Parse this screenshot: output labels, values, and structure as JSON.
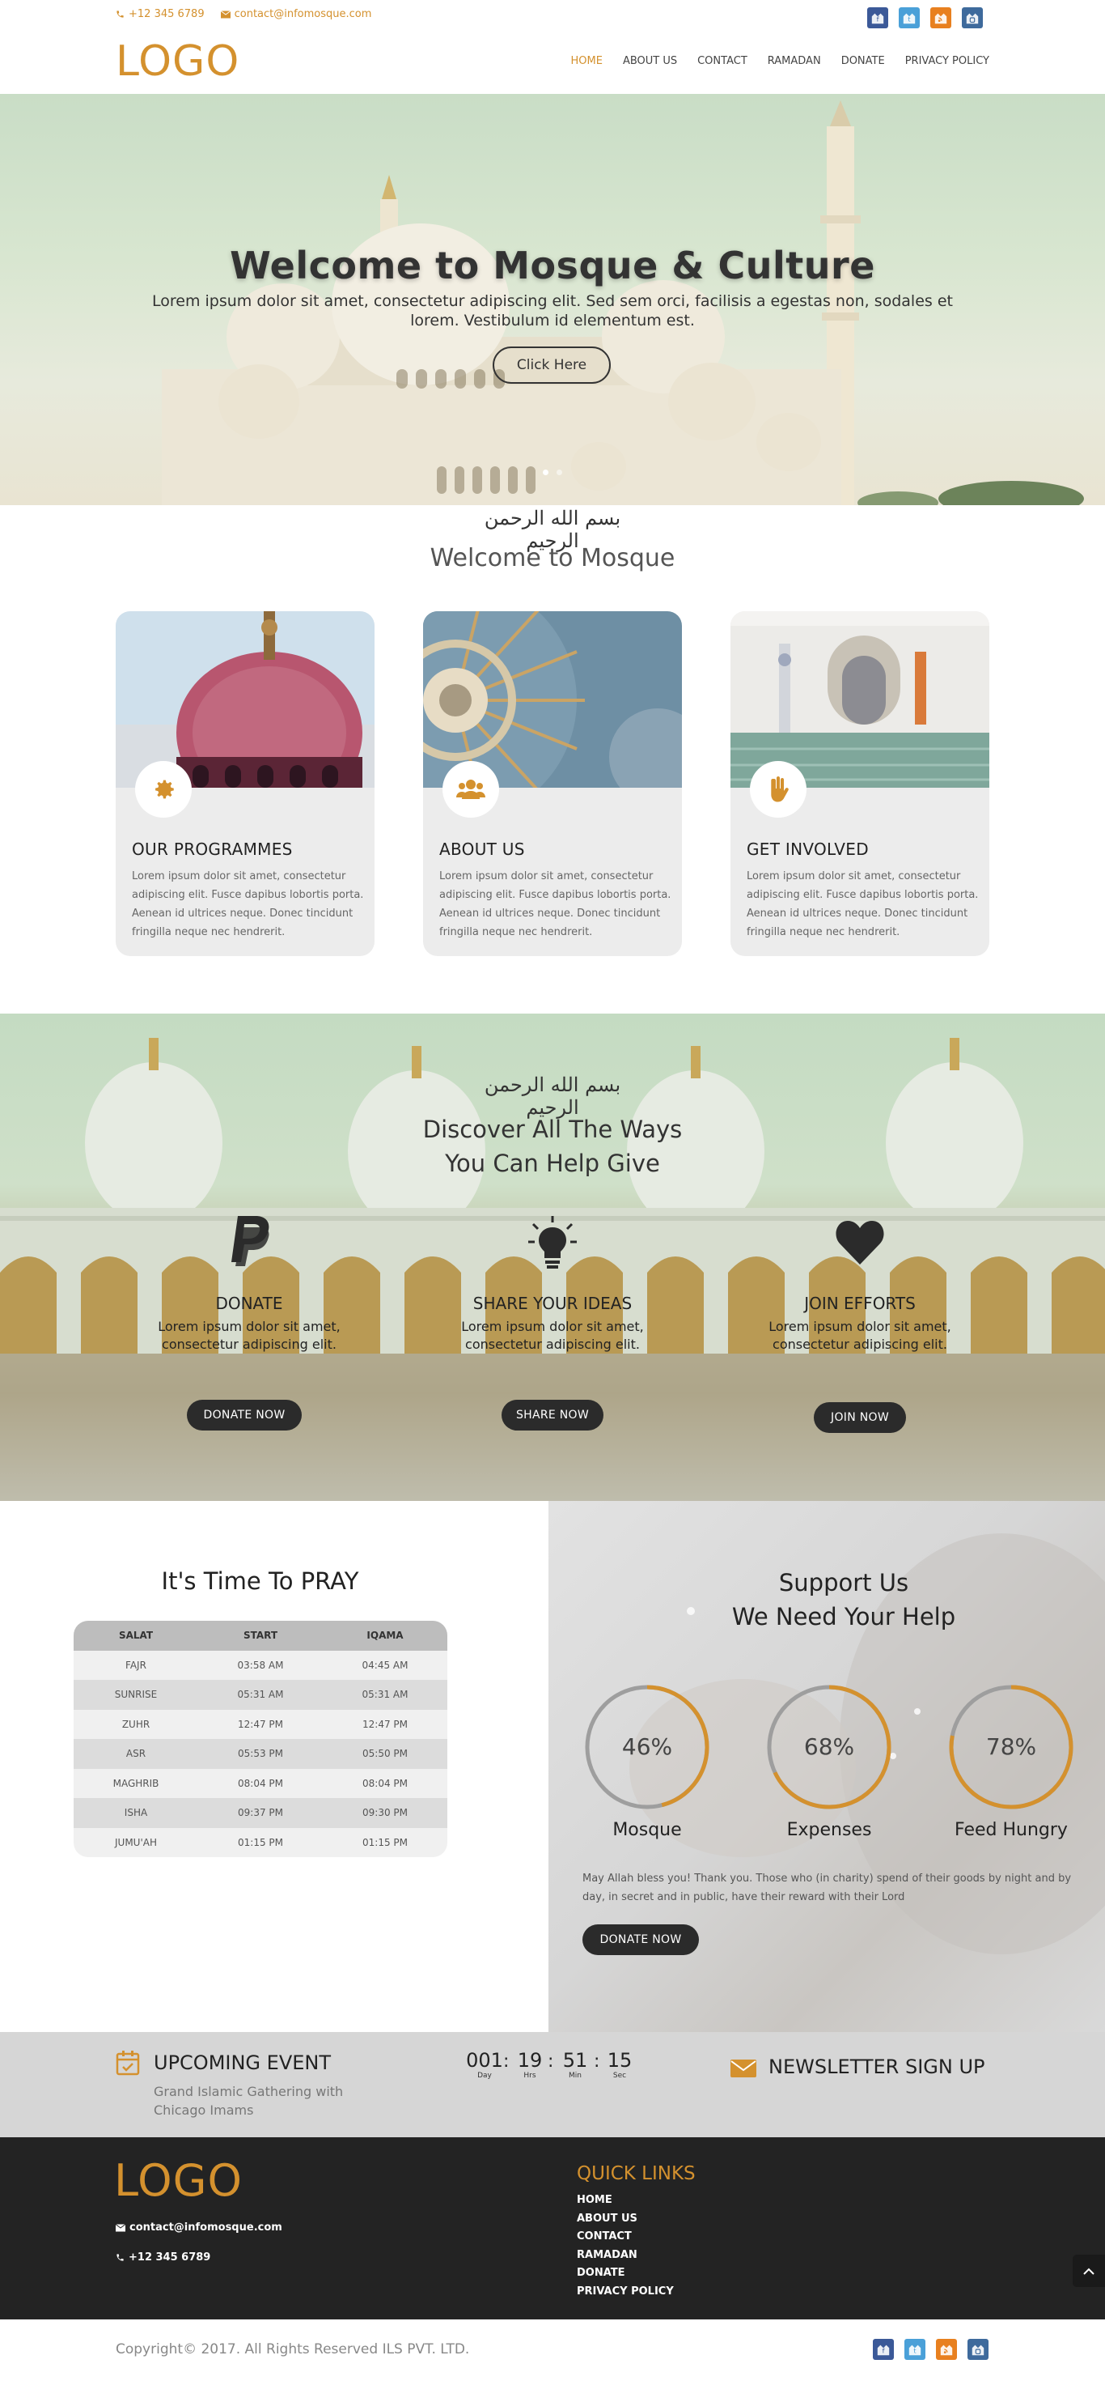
{
  "topbar": {
    "phone": "+12 345 6789",
    "email": "contact@infomosque.com",
    "social_icons": [
      "facebook-icon",
      "twitter-icon",
      "rss-icon",
      "instagram-icon"
    ]
  },
  "header": {
    "logo": "LOGO",
    "nav": [
      "HOME",
      "ABOUT US",
      "CONTACT",
      "RAMADAN",
      "DONATE",
      "PRIVACY POLICY"
    ],
    "active": "HOME"
  },
  "hero": {
    "title": "Welcome to Mosque & Culture",
    "subtitle": "Lorem ipsum dolor sit amet, consectetur adipiscing elit. Sed sem orci, facilisis a egestas non, sodales et lorem. Vestibulum id elementum est.",
    "button": "Click Here",
    "slides": 2,
    "active_slide": 1
  },
  "welcome": {
    "calligraphy": "بسم الله الرحمن الرحيم",
    "title": "Welcome to Mosque",
    "cards": [
      {
        "title": "OUR PROGRAMMES",
        "icon": "gear-icon",
        "text": "Lorem ipsum dolor sit amet, consectetur adipiscing elit. Fusce dapibus lobortis porta. Aenean id ultrices neque. Donec tincidunt fringilla neque nec hendrerit."
      },
      {
        "title": "ABOUT US",
        "icon": "users-icon",
        "text": "Lorem ipsum dolor sit amet, consectetur adipiscing elit. Fusce dapibus lobortis porta. Aenean id ultrices neque. Donec tincidunt fringilla neque nec hendrerit."
      },
      {
        "title": "GET INVOLVED",
        "icon": "hand-icon",
        "text": "Lorem ipsum dolor sit amet, consectetur adipiscing elit. Fusce dapibus lobortis porta. Aenean id ultrices neque. Donec tincidunt fringilla neque nec hendrerit."
      }
    ]
  },
  "help": {
    "calligraphy": "بسم الله الرحمن الرحيم",
    "title_line1": "Discover All The Ways",
    "title_line2": "You Can Help Give",
    "columns": [
      {
        "title": "DONATE",
        "icon": "paypal-icon",
        "text": "Lorem ipsum dolor sit amet, consectetur adipiscing elit.",
        "button": "DONATE NOW"
      },
      {
        "title": "SHARE YOUR IDEAS",
        "icon": "lightbulb-icon",
        "text": "Lorem ipsum dolor sit amet, consectetur adipiscing elit.",
        "button": "SHARE NOW"
      },
      {
        "title": "JOIN EFFORTS",
        "icon": "heart-icon",
        "text": "Lorem ipsum dolor sit amet, consectetur adipiscing elit.",
        "button": "JOIN NOW"
      }
    ]
  },
  "prayer": {
    "title": "It's Time To PRAY",
    "headers": [
      "SALAT",
      "START",
      "IQAMA"
    ],
    "rows": [
      [
        "FAJR",
        "03:58 AM",
        "04:45 AM"
      ],
      [
        "SUNRISE",
        "05:31 AM",
        "05:31 AM"
      ],
      [
        "ZUHR",
        "12:47 PM",
        "12:47 PM"
      ],
      [
        "ASR",
        "05:53 PM",
        "05:50 PM"
      ],
      [
        "MAGHRIB",
        "08:04 PM",
        "08:04 PM"
      ],
      [
        "ISHA",
        "09:37 PM",
        "09:30 PM"
      ],
      [
        "JUMU'AH",
        "01:15 PM",
        "01:15 PM"
      ]
    ]
  },
  "support": {
    "title_line1": "Support Us",
    "title_line2": "We Need Your Help",
    "circles": [
      {
        "value": 46,
        "label_value": "46%",
        "label": "Mosque"
      },
      {
        "value": 68,
        "label_value": "68%",
        "label": "Expenses"
      },
      {
        "value": 78,
        "label_value": "78%",
        "label": "Feed Hungry"
      }
    ],
    "quote": "May Allah bless you! Thank you. Those who (in charity) spend of their goods by night and by day, in secret and in public, have their reward with their Lord",
    "button": "DONATE NOW"
  },
  "events": {
    "title": "UPCOMING EVENT",
    "event_name": "Grand Islamic Gathering with Chicago Imams",
    "countdown": [
      {
        "value": "001",
        "unit": "Day"
      },
      {
        "value": "19",
        "unit": "Hrs"
      },
      {
        "value": "51",
        "unit": "Min"
      },
      {
        "value": "15",
        "unit": "Sec"
      }
    ],
    "newsletter": "NEWSLETTER SIGN UP"
  },
  "footer": {
    "logo": "LOGO",
    "email": "contact@infomosque.com",
    "phone": "+12 345 6789",
    "quick_links_title": "QUICK LINKS",
    "links": [
      "HOME",
      "ABOUT US",
      "CONTACT",
      "RAMADAN",
      "DONATE",
      "PRIVACY POLICY"
    ],
    "copyright": "Copyright© 2017. All Rights Reserved ILS PVT. LTD."
  },
  "colors": {
    "accent": "#d4912e",
    "dark": "#232323",
    "facebook": "#3b5998",
    "twitter": "#4aa0d8",
    "rss": "#e8801f",
    "instagram": "#3e6a9c"
  }
}
